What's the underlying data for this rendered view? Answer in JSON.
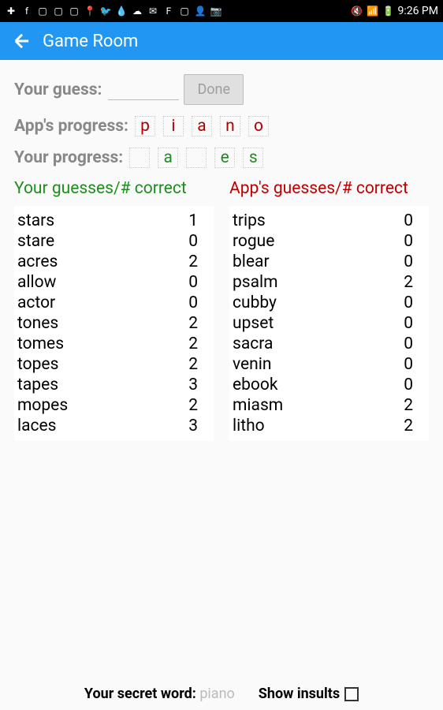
{
  "status": {
    "time": "9:26 PM"
  },
  "appbar": {
    "title": "Game Room"
  },
  "guess": {
    "label": "Your guess:",
    "done": "Done"
  },
  "app_progress": {
    "label": "App's progress:",
    "letters": [
      "p",
      "i",
      "a",
      "n",
      "o"
    ]
  },
  "your_progress": {
    "label": "Your progress:",
    "letters": [
      "",
      "a",
      "",
      "e",
      "s"
    ]
  },
  "your_table": {
    "header": "Your guesses/# correct",
    "rows": [
      {
        "word": "stars",
        "count": "1"
      },
      {
        "word": "stare",
        "count": "0"
      },
      {
        "word": "acres",
        "count": "2"
      },
      {
        "word": "allow",
        "count": "0"
      },
      {
        "word": "actor",
        "count": "0"
      },
      {
        "word": "tones",
        "count": "2"
      },
      {
        "word": "tomes",
        "count": "2"
      },
      {
        "word": "topes",
        "count": "2"
      },
      {
        "word": "tapes",
        "count": "3"
      },
      {
        "word": "mopes",
        "count": "2"
      },
      {
        "word": "laces",
        "count": "3"
      }
    ]
  },
  "app_table": {
    "header": "App's guesses/# correct",
    "rows": [
      {
        "word": "trips",
        "count": "0"
      },
      {
        "word": "rogue",
        "count": "0"
      },
      {
        "word": "blear",
        "count": "0"
      },
      {
        "word": "psalm",
        "count": "2"
      },
      {
        "word": "cubby",
        "count": "0"
      },
      {
        "word": "upset",
        "count": "0"
      },
      {
        "word": "sacra",
        "count": "0"
      },
      {
        "word": "venin",
        "count": "0"
      },
      {
        "word": "ebook",
        "count": "0"
      },
      {
        "word": "miasm",
        "count": "2"
      },
      {
        "word": "litho",
        "count": "2"
      }
    ]
  },
  "bottom": {
    "secret_label": "Your secret word:",
    "secret_word": "piano",
    "show_insults": "Show insults"
  }
}
